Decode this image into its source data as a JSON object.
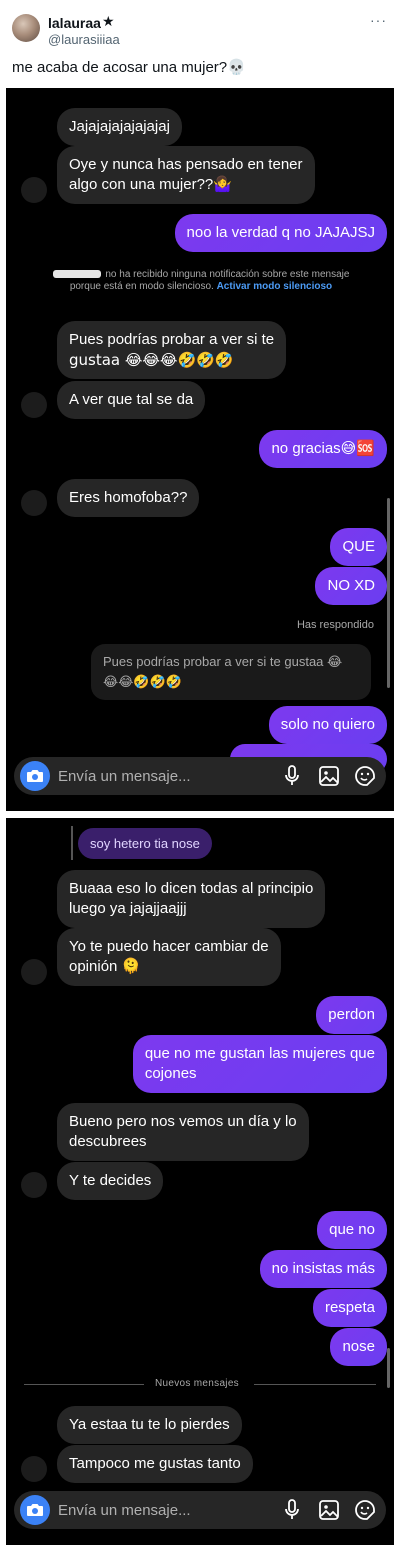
{
  "tweet": {
    "display_name": "lalauraa",
    "star": "★",
    "handle": "@laurasiiiaa",
    "more": "···",
    "text": "me acaba de acosar una mujer?💀"
  },
  "panel1": {
    "messages": [
      {
        "side": "recv",
        "text": "Jajajajajajajajaj"
      },
      {
        "side": "recv",
        "line1": "Oye y nunca has pensado en tener",
        "line2": "algo con una mujer??🤷‍♀️"
      },
      {
        "side": "sent",
        "text": "noo la verdad q no JAJAJSJ"
      },
      {
        "side": "recv",
        "line1": "Pues podrías probar a ver si te",
        "line2": "gustaa 😂😂😂🤣🤣🤣"
      },
      {
        "side": "recv",
        "text": "A ver que tal se da"
      },
      {
        "side": "sent",
        "text": "no gracias😅🆘"
      },
      {
        "side": "recv",
        "text": "Eres homofoba??"
      },
      {
        "side": "sent",
        "text": "QUE"
      },
      {
        "side": "sent",
        "text": "NO XD"
      },
      {
        "side": "sent",
        "text": "solo no quiero"
      }
    ],
    "notice": {
      "text": "no ha recibido ninguna notificación sobre este mensaje porque está en modo silencioso.",
      "link": "Activar modo silencioso"
    },
    "replied_label": "Has respondido",
    "quote": {
      "line1": "Pues podrías probar a ver si te gustaa 😂",
      "line2": "😂😂🤣🤣🤣"
    }
  },
  "panel2": {
    "reply_context": "soy hetero tia nose",
    "messages": [
      {
        "side": "recv",
        "line1": "Buaaa eso lo dicen todas al principio",
        "line2": "luego ya jajajjaajjj"
      },
      {
        "side": "recv",
        "line1": "Yo te puedo hacer cambiar de",
        "line2": "opinión 🫠"
      },
      {
        "side": "sent",
        "text": "perdon"
      },
      {
        "side": "sent",
        "line1": "que no me gustan las mujeres que",
        "line2": "cojones"
      },
      {
        "side": "recv",
        "line1": "Bueno pero nos vemos un día y lo",
        "line2": "descubrees"
      },
      {
        "side": "recv",
        "text": "Y te decides"
      },
      {
        "side": "sent",
        "text": "que no"
      },
      {
        "side": "sent",
        "text": "no insistas más"
      },
      {
        "side": "sent",
        "text": "respeta"
      },
      {
        "side": "sent",
        "text": "nose"
      },
      {
        "side": "recv",
        "text": "Ya estaa tu te lo pierdes"
      },
      {
        "side": "recv",
        "text": "Tampoco me gustas tanto"
      }
    ],
    "divider": "Nuevos mensajes"
  },
  "composer": {
    "placeholder": "Envía un mensaje..."
  },
  "icons": [
    "camera-icon",
    "microphone-icon",
    "gallery-icon",
    "sticker-icon",
    "star-icon",
    "more-icon"
  ],
  "colors": {
    "sent_bubble": "#7d39ef",
    "recv_bubble": "#262626",
    "camera": "#3b82f6",
    "link": "#4c9bf5"
  }
}
